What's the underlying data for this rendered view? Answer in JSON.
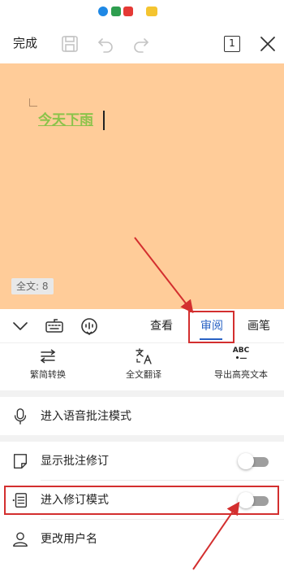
{
  "toolbar": {
    "done_label": "完成",
    "page_count": "1"
  },
  "document": {
    "text": "今天下雨",
    "word_count": "全文: 8",
    "background_color": "#ffcc99",
    "text_color": "#8bc34a"
  },
  "tabs": [
    {
      "label": "查看",
      "active": false
    },
    {
      "label": "审阅",
      "active": true
    },
    {
      "label": "画笔",
      "active": false
    }
  ],
  "tools": [
    {
      "label": "繁简转换",
      "icon": "convert-icon"
    },
    {
      "label": "全文翻译",
      "icon": "translate-icon"
    },
    {
      "label": "导出高亮文本",
      "icon": "abc-export-icon",
      "icon_text_top": "ABC",
      "icon_text_bottom": "•—"
    }
  ],
  "menu": {
    "voice_annotation": {
      "label": "进入语音批注模式",
      "icon": "microphone-icon"
    },
    "show_revisions": {
      "label": "显示批注修订",
      "icon": "note-icon",
      "toggle_on": false
    },
    "revision_mode": {
      "label": "进入修订模式",
      "icon": "revise-list-icon",
      "toggle_on": false
    },
    "change_username": {
      "label": "更改用户名",
      "icon": "person-icon"
    }
  },
  "colors": {
    "accent": "#2962c4",
    "annotation": "#d32f2f",
    "toggle_off": "#9e9e9e"
  }
}
